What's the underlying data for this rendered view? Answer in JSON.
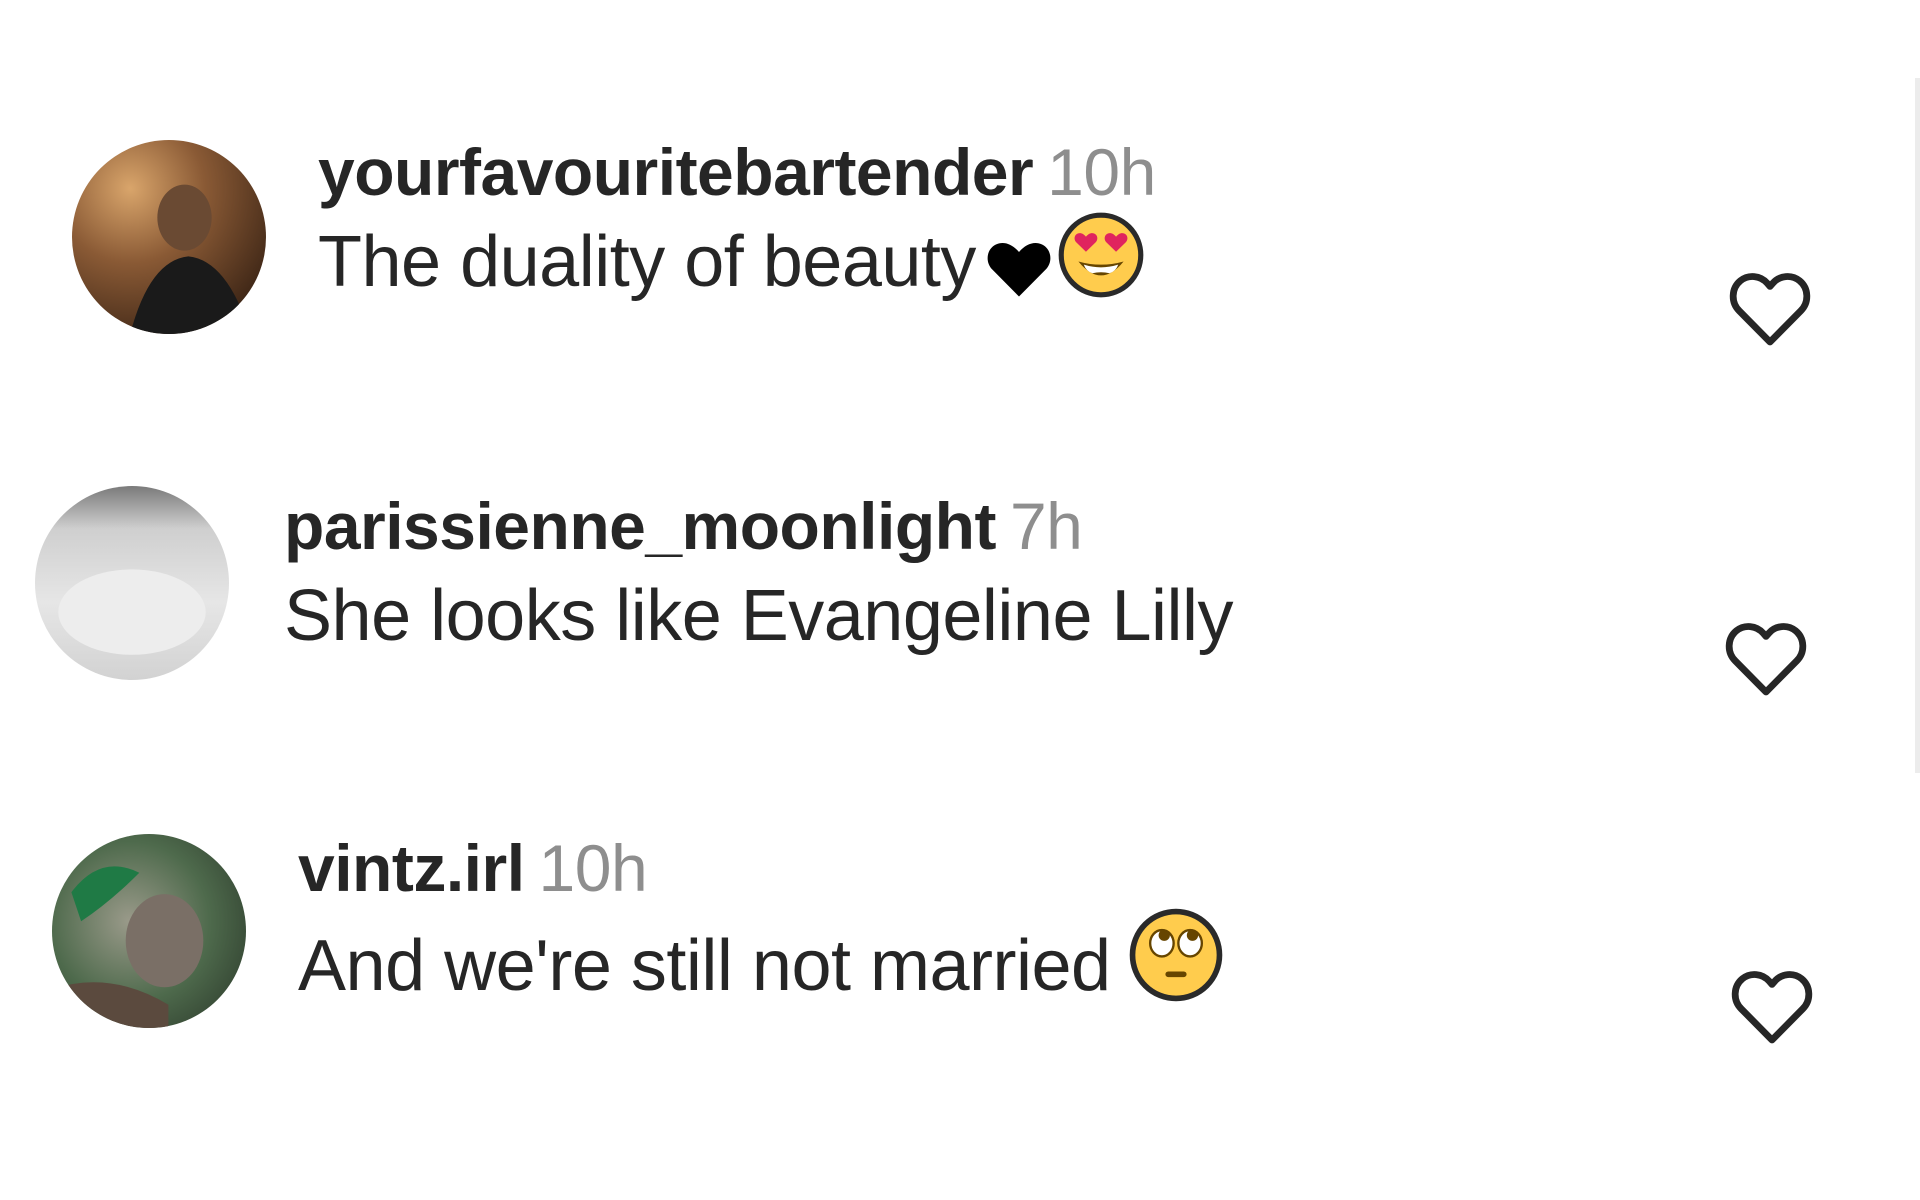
{
  "comments": [
    {
      "username": "yourfavouritebartender",
      "time": "10h",
      "text": "The duality of beauty",
      "emojis": [
        "black-heart-icon",
        "heart-eyes-emoji-icon"
      ],
      "avatar_color": "#5a3a22"
    },
    {
      "username": "parissienne_moonlight",
      "time": "7h",
      "text": "She looks like Evangeline Lilly",
      "emojis": [],
      "avatar_color": "#d9d9d9"
    },
    {
      "username": "vintz.irl",
      "time": "10h",
      "text": "And we're still not married",
      "emojis": [
        "eye-roll-emoji-icon"
      ],
      "avatar_color": "#4f6a4a"
    }
  ],
  "icons": {
    "like": "heart-outline-icon"
  },
  "colors": {
    "username": "#262626",
    "time": "#8e8e8e",
    "text": "#262626",
    "icon_stroke": "#262626"
  }
}
